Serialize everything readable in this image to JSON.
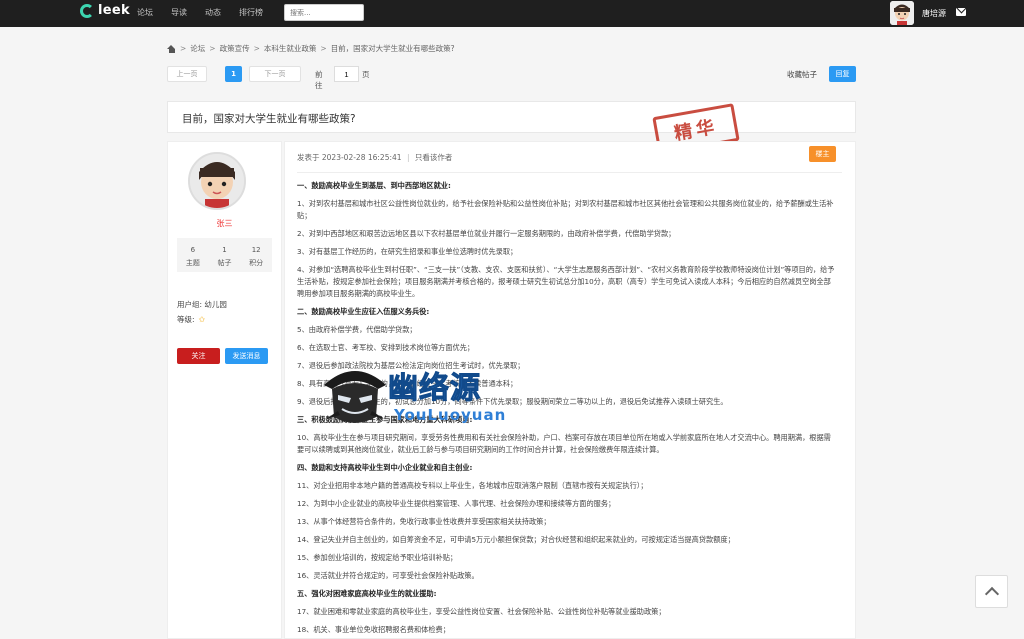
{
  "topbar": {
    "logo_text": "leek",
    "nav": [
      "论坛",
      "导读",
      "动态",
      "排行榜"
    ],
    "search_placeholder": "搜索...",
    "username": "唐培源",
    "icons": {
      "logo": "leek-logo-icon",
      "mail": "mail-icon"
    }
  },
  "breadcrumb": {
    "items": [
      "论坛",
      "政策宣传",
      "本科生就业政策",
      "目前，国家对大学生就业有哪些政策?"
    ],
    "separator": ">"
  },
  "pager": {
    "prev": "上一页",
    "current": "1",
    "next": "下一页",
    "goto_label": "前往",
    "goto_value": "1",
    "page_label": "页"
  },
  "actions": {
    "favorite": "收藏帖子",
    "reply": "回复"
  },
  "thread": {
    "title": "目前，国家对大学生就业有哪些政策?",
    "stamp": "精华"
  },
  "author": {
    "name": "张三",
    "stats": [
      {
        "value": "6",
        "label": "主题"
      },
      {
        "value": "1",
        "label": "帖子"
      },
      {
        "value": "12",
        "label": "积分"
      }
    ],
    "user_group": "用户组: 幼儿园",
    "level_label": "等级:",
    "follow": "关注",
    "message": "发送消息"
  },
  "post": {
    "posted_at": "发表于 2023-02-28 16:25:41",
    "divider": "|",
    "author_only": "只看该作者",
    "owner_badge": "楼主",
    "paragraphs": [
      {
        "bold": true,
        "text": "一、鼓励高校毕业生到基层、到中西部地区就业:"
      },
      {
        "bold": false,
        "text": "1、对到农村基层和城市社区公益性岗位就业的，给予社会保险补贴和公益性岗位补贴；对到农村基层和城市社区其他社会管理和公共服务岗位就业的，给予薪酬或生活补贴；"
      },
      {
        "bold": false,
        "text": "2、对到中西部地区和艰苦边远地区县以下农村基层单位就业并履行一定服务期限的，由政府补偿学费，代偿助学贷款；"
      },
      {
        "bold": false,
        "text": "3、对有基层工作经历的，在研究生招录和事业单位选聘时优先录取；"
      },
      {
        "bold": false,
        "text": "4、对参加“选聘高校毕业生到村任职”、“三支一扶”（支教、支农、支医和扶贫）、“大学生志愿服务西部计划”、“农村义务教育阶段学校教师特设岗位计划”等项目的，给予生活补贴，按规定参加社会保险；项目服务期满并考核合格的，报考硕士研究生初试总分加10分，高职（高专）学生可免试入读成人本科；今后相应的自然减员空岗全部聘用参加项目服务期满的高校毕业生。"
      },
      {
        "bold": true,
        "text": "二、鼓励高校毕业生应征入伍服义务兵役:"
      },
      {
        "bold": false,
        "text": "5、由政府补偿学费，代偿助学贷款；"
      },
      {
        "bold": false,
        "text": "6、在选取士官、考军校、安排到技术岗位等方面优先；"
      },
      {
        "bold": false,
        "text": "7、退役后参加政法院校为基层公检法定向岗位招生考试时，优先录取；"
      },
      {
        "bold": false,
        "text": "8、具有高职（高专）学历的，退役后经过一定考核，入读普通本科；"
      },
      {
        "bold": false,
        "text": "9、退役后报考硕士研究生的，初试总分加10分，同等条件下优先录取；服役期间荣立二等功以上的，退役后免试推荐入读硕士研究生。"
      },
      {
        "bold": true,
        "text": "三、积极鼓励高校毕业生参与国家和地方重大科研项目:"
      },
      {
        "bold": false,
        "text": "10、高校毕业生在参与项目研究期间，享受劳务性费用和有关社会保险补助，户口、档案可存放在项目单位所在地或入学前家庭所在地人才交流中心。聘用期满，根据需要可以续聘或到其他岗位就业，就业后工龄与参与项目研究期间的工作时间合并计算，社会保险缴费年限连续计算。"
      },
      {
        "bold": true,
        "text": "四、鼓励和支持高校毕业生到中小企业就业和自主创业:"
      },
      {
        "bold": false,
        "text": "11、对企业招用非本地户籍的普通高校专科以上毕业生，各地城市应取消落户限制（直辖市按有关规定执行）；"
      },
      {
        "bold": false,
        "text": "12、为到中小企业就业的高校毕业生提供档案管理、人事代理、社会保险办理和接续等方面的服务；"
      },
      {
        "bold": false,
        "text": "13、从事个体经营符合条件的，免收行政事业性收费并享受国家相关扶持政策；"
      },
      {
        "bold": false,
        "text": "14、登记失业并自主创业的，如自筹资金不足，可申请5万元小额担保贷款；对合伙经营和组织起来就业的，可按规定适当提高贷款额度；"
      },
      {
        "bold": false,
        "text": "15、参加创业培训的，按规定给予职业培训补贴；"
      },
      {
        "bold": false,
        "text": "16、灵活就业并符合规定的，可享受社会保险补贴政策。"
      },
      {
        "bold": true,
        "text": "五、强化对困难家庭高校毕业生的就业援助:"
      },
      {
        "bold": false,
        "text": "17、就业困难和零就业家庭的高校毕业生，享受公益性岗位安置、社会保险补贴、公益性岗位补贴等就业援助政策；"
      },
      {
        "bold": false,
        "text": "18、机关、事业单位免收招聘报名费和体检费；"
      }
    ]
  },
  "watermark": {
    "cn": "幽络源",
    "en": "YouLuoyuan"
  },
  "colors": {
    "topbar": "#1f1f1f",
    "primary": "#2b9af3",
    "danger": "#c81e1e",
    "owner": "#f7902a",
    "logo": "#3dd5b0"
  }
}
